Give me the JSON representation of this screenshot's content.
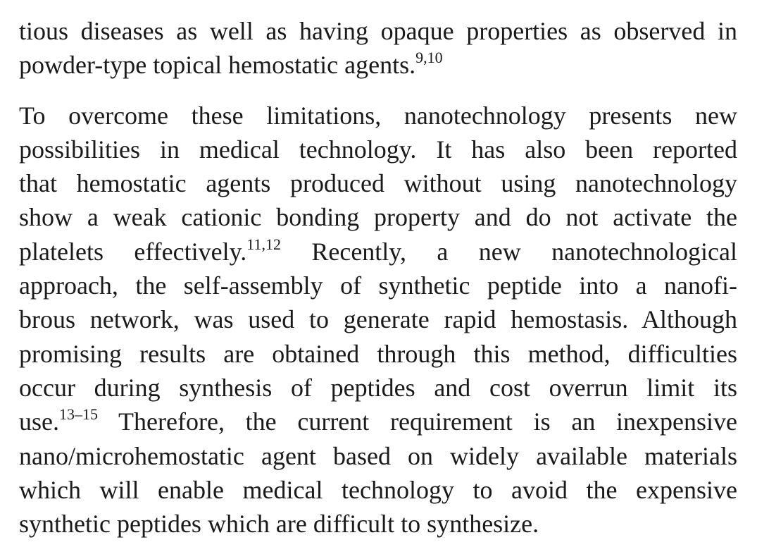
{
  "paragraphs": [
    {
      "lines": [
        {
          "text": "tious diseases as well as having opaque properties as observed in"
        },
        {
          "text": "powder-type topical hemostatic agents.",
          "sup": "9,10"
        }
      ]
    },
    {
      "lines": [
        {
          "text": "To overcome these limitations, nanotechnology presents new"
        },
        {
          "text": "possibilities in medical technology. It has also been reported"
        },
        {
          "text": "that hemostatic agents produced without using nanotechnology"
        },
        {
          "text": "show a weak cationic bonding property and do not activate the"
        },
        {
          "text": "platelets effectively.",
          "sup": "11,12",
          "after": " Recently, a new nanotechnological"
        },
        {
          "text": "approach, the self-assembly of synthetic peptide into a nanofi-"
        },
        {
          "text": "brous network, was used to generate rapid hemostasis. Although"
        },
        {
          "text": "promising results are obtained through this method, difficulties"
        },
        {
          "text": "occur during synthesis of peptides and cost overrun limit its"
        },
        {
          "text": "use.",
          "sup": "13–15",
          "after": " Therefore, the current requirement is an inexpensive"
        },
        {
          "text": "nano/microhemostatic agent based on widely available materials"
        },
        {
          "text": "which will enable medical technology to avoid the expensive"
        },
        {
          "text": "synthetic peptides which are difficult to synthesize."
        }
      ]
    }
  ]
}
